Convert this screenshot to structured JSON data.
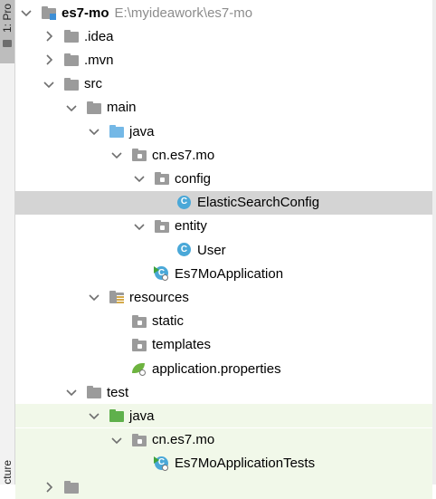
{
  "tool_window": {
    "project_tab_label": "1: Pro",
    "structure_tab_label": "cture"
  },
  "tree": [
    {
      "label": "es7-mo",
      "path_hint": "E:\\myideawork\\es7-mo",
      "bold": true,
      "arrow": "down",
      "icon": "module-folder-icon",
      "icon_style": "grey",
      "indent": 0
    },
    {
      "label": ".idea",
      "arrow": "right",
      "icon": "folder-icon",
      "icon_style": "grey",
      "indent": 1
    },
    {
      "label": ".mvn",
      "arrow": "right",
      "icon": "folder-icon",
      "icon_style": "grey",
      "indent": 1
    },
    {
      "label": "src",
      "arrow": "down",
      "icon": "folder-icon",
      "icon_style": "grey",
      "indent": 1
    },
    {
      "label": "main",
      "arrow": "down",
      "icon": "folder-icon",
      "icon_style": "grey",
      "indent": 2
    },
    {
      "label": "java",
      "arrow": "down",
      "icon": "source-root-folder-icon",
      "icon_style": "blue",
      "indent": 3
    },
    {
      "label": "cn.es7.mo",
      "arrow": "down",
      "icon": "package-icon",
      "icon_style": "grey",
      "indent": 4
    },
    {
      "label": "config",
      "arrow": "down",
      "icon": "package-icon",
      "icon_style": "grey",
      "indent": 5
    },
    {
      "label": "ElasticSearchConfig",
      "arrow": "none",
      "icon": "java-class-icon",
      "indent": 6,
      "selected": true
    },
    {
      "label": "entity",
      "arrow": "down",
      "icon": "package-icon",
      "icon_style": "grey",
      "indent": 5
    },
    {
      "label": "User",
      "arrow": "none",
      "icon": "java-class-icon",
      "indent": 6
    },
    {
      "label": "Es7MoApplication",
      "arrow": "none",
      "icon": "spring-boot-class-icon",
      "indent": 5
    },
    {
      "label": "resources",
      "arrow": "down",
      "icon": "resources-folder-icon",
      "icon_style": "grey",
      "indent": 3
    },
    {
      "label": "static",
      "arrow": "none",
      "icon": "package-icon",
      "icon_style": "grey",
      "indent": 4
    },
    {
      "label": "templates",
      "arrow": "none",
      "icon": "package-icon",
      "icon_style": "grey",
      "indent": 4
    },
    {
      "label": "application.properties",
      "arrow": "none",
      "icon": "spring-properties-icon",
      "indent": 4
    },
    {
      "label": "test",
      "arrow": "down",
      "icon": "folder-icon",
      "icon_style": "grey",
      "indent": 2
    },
    {
      "label": "java",
      "arrow": "down",
      "icon": "test-root-folder-icon",
      "icon_style": "green",
      "indent": 3,
      "test": true
    },
    {
      "label": "cn.es7.mo",
      "arrow": "down",
      "icon": "package-icon",
      "icon_style": "grey",
      "indent": 4,
      "test": true
    },
    {
      "label": "Es7MoApplicationTests",
      "arrow": "none",
      "icon": "spring-boot-test-class-icon",
      "indent": 5,
      "test": true
    },
    {
      "label": "",
      "arrow": "right",
      "icon": "folder-icon",
      "icon_style": "grey",
      "indent": 1,
      "test": true,
      "clipped": true
    }
  ]
}
